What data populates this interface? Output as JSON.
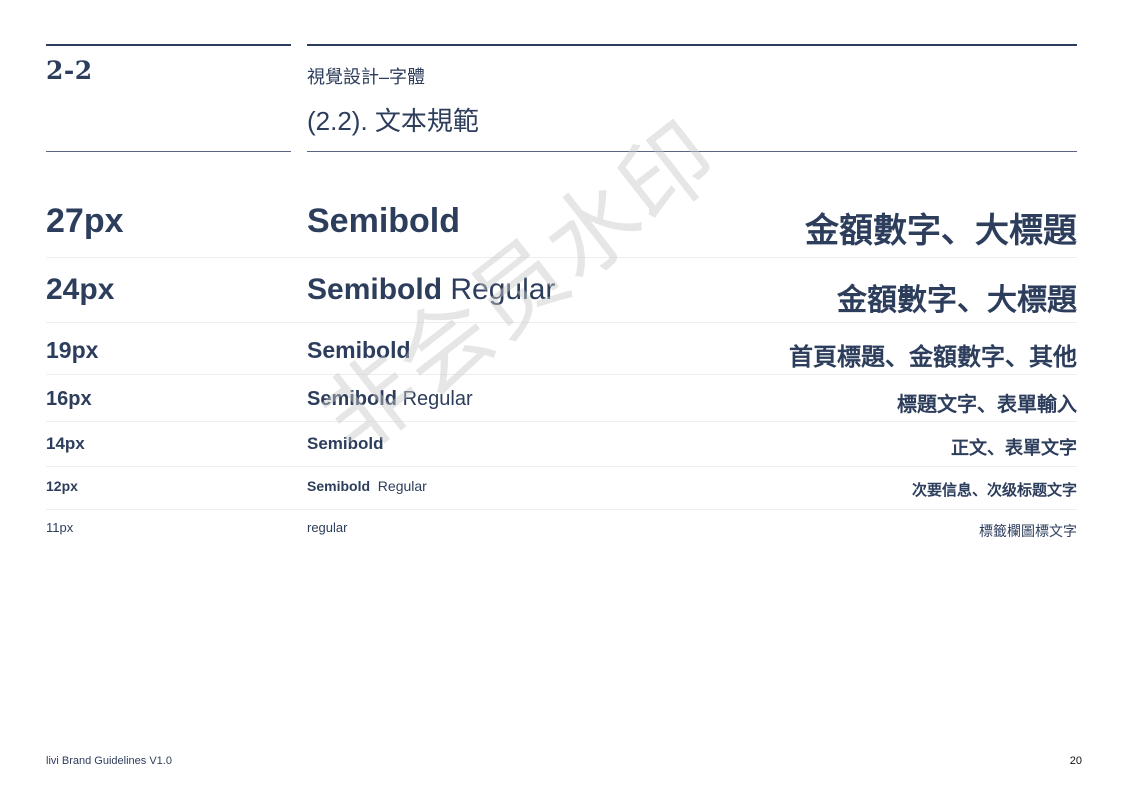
{
  "header": {
    "section_number": "2-2",
    "subtitle": "視覺設計–字體",
    "title": "(2.2). 文本規範"
  },
  "type_scale": [
    {
      "size": "27px",
      "weights": [
        "Semibold"
      ],
      "usage": "金額數字、大標題"
    },
    {
      "size": "24px",
      "weights": [
        "Semibold",
        "Regular"
      ],
      "usage": "金額數字、大標題"
    },
    {
      "size": "19px",
      "weights": [
        "Semibold"
      ],
      "usage": "首頁標題、金額數字、其他"
    },
    {
      "size": "16px",
      "weights": [
        "Semibold",
        "Regular"
      ],
      "usage": "標題文字、表單輸入"
    },
    {
      "size": "14px",
      "weights": [
        "Semibold"
      ],
      "usage": "正文、表單文字"
    },
    {
      "size": "12px",
      "weights": [
        "Semibold",
        "Regular"
      ],
      "usage": "次要信息、次级标题文字"
    },
    {
      "size": "11px",
      "weights": [
        "regular"
      ],
      "usage": "標籤欄圖標文字"
    }
  ],
  "watermark": "非会员水印",
  "footer": {
    "brand": "livi Brand Guidelines V1.0",
    "page_number": "20"
  }
}
